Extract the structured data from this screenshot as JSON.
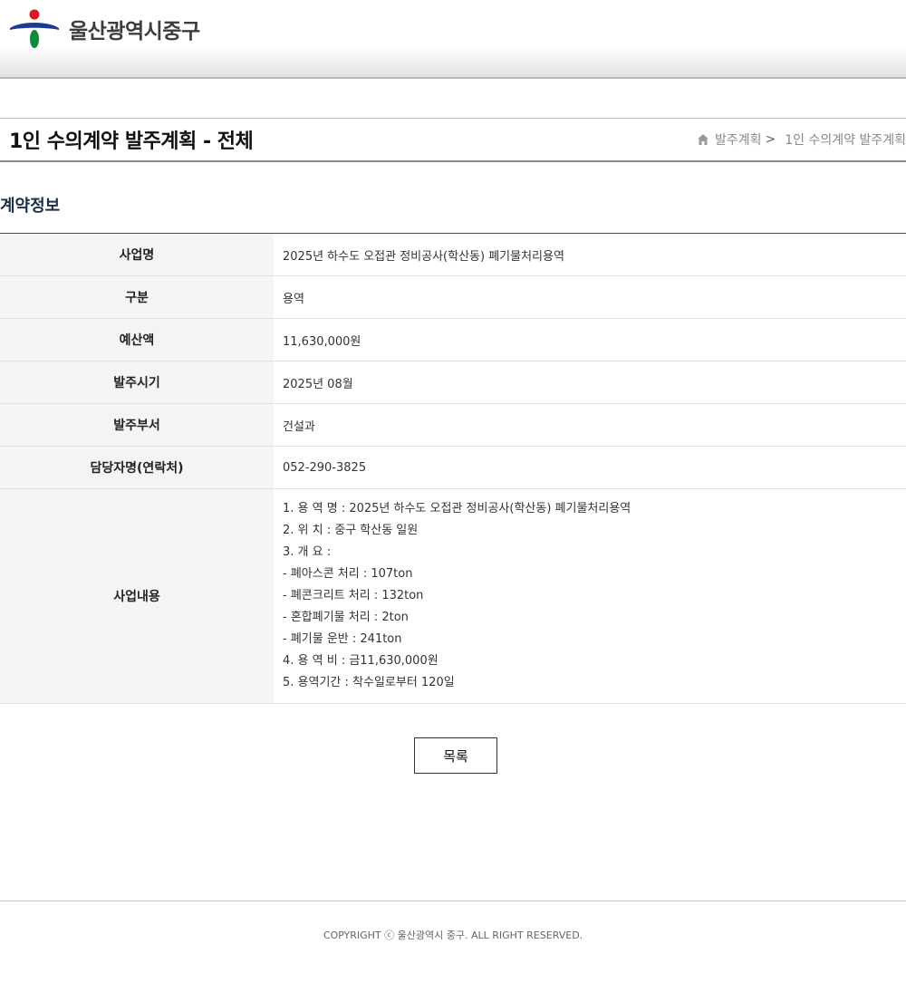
{
  "header": {
    "logo_text": "울산광역시중구"
  },
  "title_bar": {
    "page_title": "1인 수의계약 발주계획 - 전체",
    "breadcrumb": [
      "발주계획",
      "1인 수의계약 발주계획"
    ],
    "breadcrumb_sep": ">"
  },
  "section": {
    "title": "계약정보"
  },
  "table": {
    "rows": [
      {
        "label": "사업명",
        "value": "2025년 하수도 오접관 정비공사(학산동) 폐기물처리용역"
      },
      {
        "label": "구분",
        "value": "용역"
      },
      {
        "label": "예산액",
        "value": "11,630,000원"
      },
      {
        "label": "발주시기",
        "value": "2025년 08월"
      },
      {
        "label": "발주부서",
        "value": "건설과"
      },
      {
        "label": "담당자명(연락처)",
        "value": "052-290-3825"
      }
    ],
    "content": {
      "label": "사업내용",
      "lines": [
        "1. 용 역 명 : 2025년 하수도 오접관 정비공사(학산동) 폐기물처리용역",
        "2. 위 치 : 중구 학산동 일원",
        "3. 개 요 :",
        "- 폐아스콘 처리 : 107ton",
        "- 폐콘크리트 처리 : 132ton",
        "- 혼합폐기물 처리 : 2ton",
        "- 폐기물 운반 : 241ton",
        "4. 용 역 비 : 금11,630,000원",
        "5. 용역기간 : 착수일로부터 120일"
      ]
    }
  },
  "buttons": {
    "list_label": "목록"
  },
  "footer": {
    "copyright": "COPYRIGHT ⓒ 울산광역시 중구. ALL RIGHT RESERVED."
  },
  "colors": {
    "logo_red": "#d7161e",
    "logo_blue": "#1f3a93",
    "logo_green": "#0f8a3c",
    "section_title": "#1c3146"
  }
}
